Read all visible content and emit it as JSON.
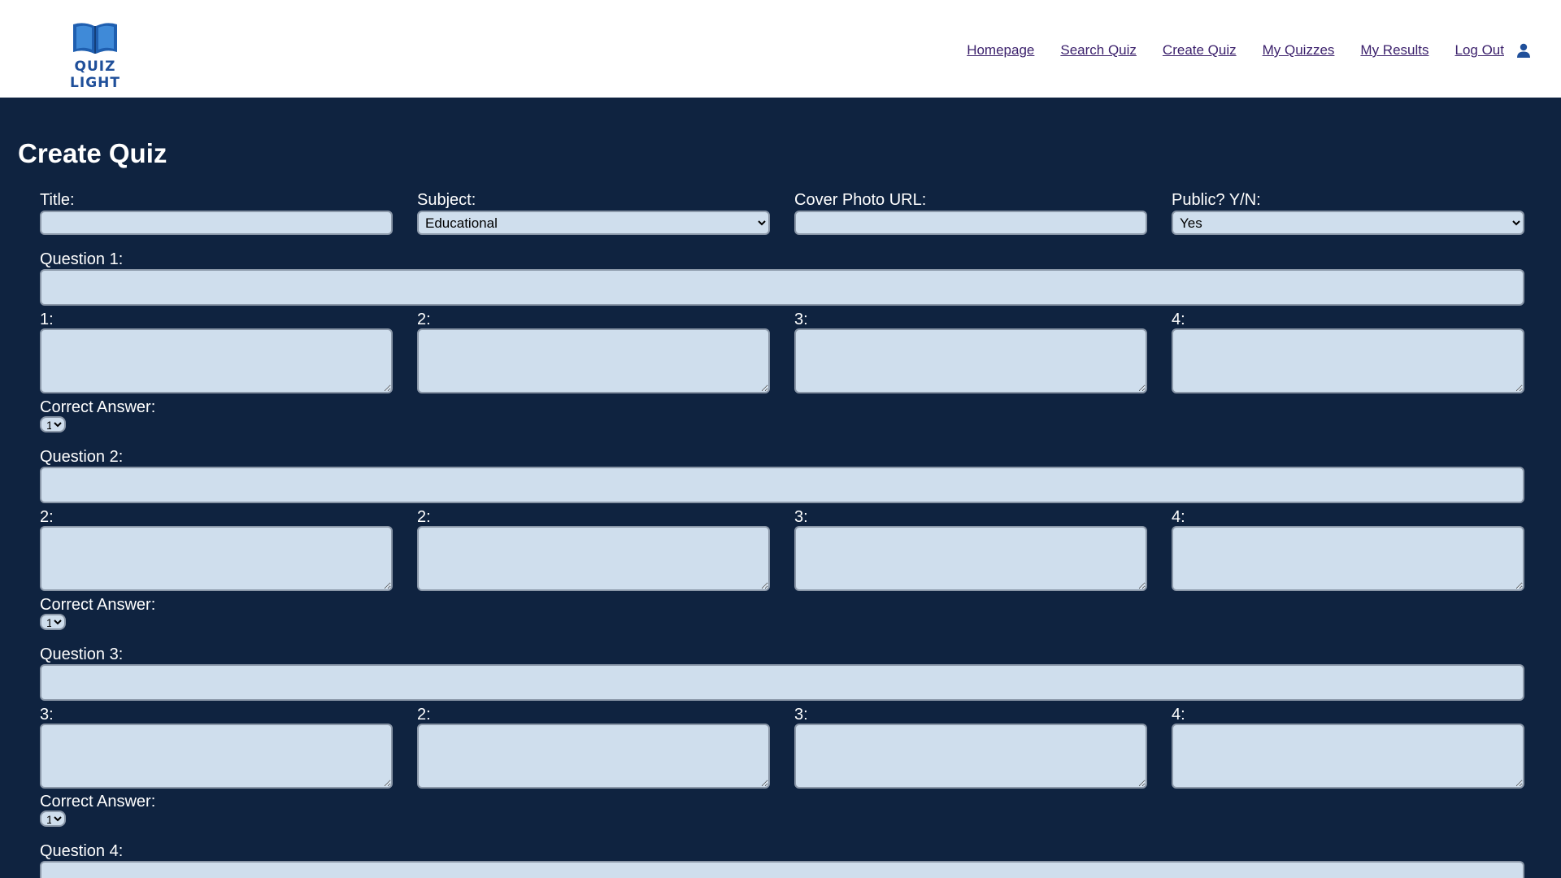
{
  "brand": {
    "name": "QUIZ LIGHT"
  },
  "nav": {
    "items": [
      "Homepage",
      "Search Quiz",
      "Create Quiz",
      "My Quizzes",
      "My Results",
      "Log Out"
    ]
  },
  "page": {
    "title": "Create Quiz"
  },
  "form": {
    "title_label": "Title:",
    "title_value": "",
    "subject_label": "Subject:",
    "subject_value": "Educational",
    "cover_label": "Cover Photo URL:",
    "cover_value": "",
    "public_label": "Public? Y/N:",
    "public_value": "Yes"
  },
  "questions": [
    {
      "label": "Question 1:",
      "answer_labels": [
        "1:",
        "2:",
        "3:",
        "4:"
      ],
      "correct_label": "Correct Answer:",
      "correct_value": "1"
    },
    {
      "label": "Question 2:",
      "answer_labels": [
        "2:",
        "2:",
        "3:",
        "4:"
      ],
      "correct_label": "Correct Answer:",
      "correct_value": "1"
    },
    {
      "label": "Question 3:",
      "answer_labels": [
        "3:",
        "2:",
        "3:",
        "4:"
      ],
      "correct_label": "Correct Answer:",
      "correct_value": "1"
    },
    {
      "label": "Question 4:"
    }
  ],
  "colors": {
    "background": "#0f2340",
    "header": "#ffffff",
    "field": "#cfdeed",
    "link": "#3a1f6b",
    "brand": "#1f4f9a"
  }
}
